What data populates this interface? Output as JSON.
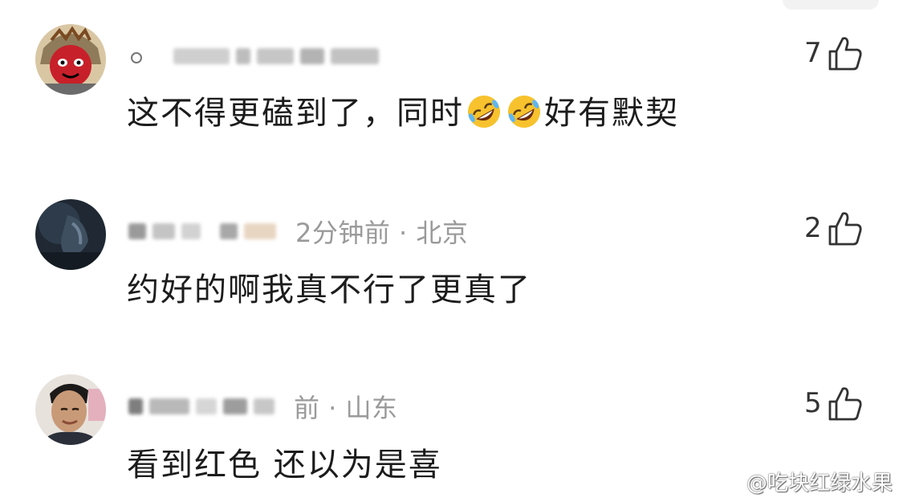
{
  "comments": [
    {
      "meta": "",
      "text_before": "这不得更磕到了，同时",
      "emoji_names": [
        "rofl-emoji",
        "rofl-emoji"
      ],
      "text_after": "好有默契",
      "likes": "7"
    },
    {
      "meta": "2分钟前 · 北京",
      "text": "约好的啊我真不行了更真了",
      "likes": "2"
    },
    {
      "meta": "前 · 山东",
      "text": "看到红色 还以为是喜",
      "likes": "5"
    }
  ],
  "watermark": {
    "text": "@吃块红绿水果",
    "icon": "weibo-icon"
  },
  "colors": {
    "text": "#1c1c1c",
    "meta": "#9a9a9a",
    "like_icon": "#333333",
    "emoji_face": "#f7c22d"
  }
}
